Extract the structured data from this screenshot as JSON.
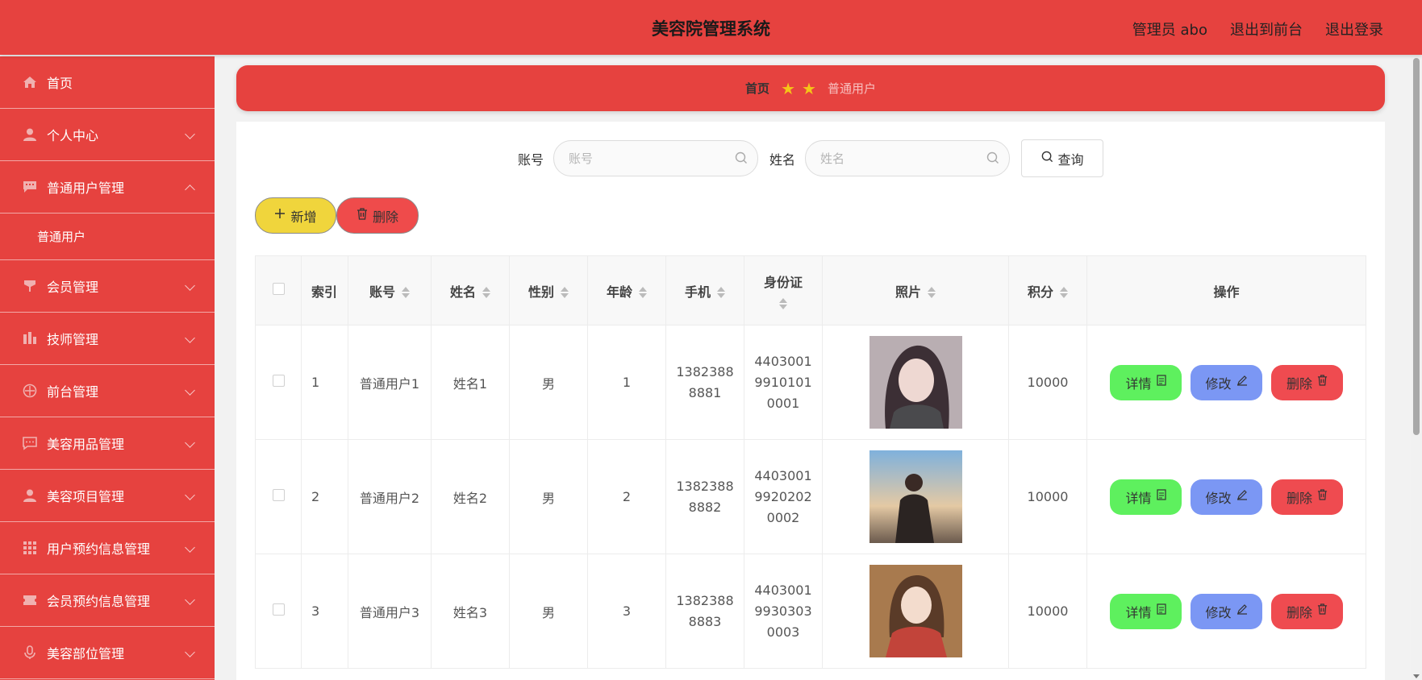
{
  "header": {
    "title": "美容院管理系统",
    "admin_label": "管理员 abo",
    "front_label": "退出到前台",
    "logout_label": "退出登录"
  },
  "sidebar": {
    "items": [
      {
        "label": "首页",
        "icon": "home-icon"
      },
      {
        "label": "个人中心",
        "icon": "user-icon"
      },
      {
        "label": "普通用户管理",
        "icon": "chat-icon",
        "expanded": true
      },
      {
        "label": "会员管理",
        "icon": "cup-icon"
      },
      {
        "label": "技师管理",
        "icon": "chart-icon"
      },
      {
        "label": "前台管理",
        "icon": "compass-icon"
      },
      {
        "label": "美容用品管理",
        "icon": "message-icon"
      },
      {
        "label": "美容项目管理",
        "icon": "user-icon"
      },
      {
        "label": "用户预约信息管理",
        "icon": "grid-icon"
      },
      {
        "label": "会员预约信息管理",
        "icon": "ticket-icon"
      },
      {
        "label": "美容部位管理",
        "icon": "mic-icon"
      }
    ],
    "sub_item": "普通用户"
  },
  "breadcrumb": {
    "home": "首页",
    "current": "普通用户",
    "separator_icon": "star-icon"
  },
  "search": {
    "account_label": "账号",
    "account_placeholder": "账号",
    "name_label": "姓名",
    "name_placeholder": "姓名",
    "query_label": "查询"
  },
  "actions": {
    "add_label": "新增",
    "delete_label": "删除"
  },
  "table": {
    "columns": [
      "索引",
      "账号",
      "姓名",
      "性别",
      "年龄",
      "手机",
      "身份证",
      "照片",
      "积分",
      "操作"
    ],
    "rows": [
      {
        "index": "1",
        "account": "普通用户1",
        "name": "姓名1",
        "gender": "男",
        "age": "1",
        "phone": "13823888881",
        "id_card": "440300199101010001",
        "points": "10000"
      },
      {
        "index": "2",
        "account": "普通用户2",
        "name": "姓名2",
        "gender": "男",
        "age": "2",
        "phone": "13823888882",
        "id_card": "440300199202020002",
        "points": "10000"
      },
      {
        "index": "3",
        "account": "普通用户3",
        "name": "姓名3",
        "gender": "男",
        "age": "3",
        "phone": "13823888883",
        "id_card": "440300199303030003",
        "points": "10000"
      }
    ],
    "ops": {
      "detail": "详情",
      "edit": "修改",
      "delete": "删除"
    }
  },
  "colors": {
    "primary": "#e6423f",
    "add_button": "#f0d53c",
    "delete_button": "#ef4b4b",
    "detail_button": "#5ef05e",
    "edit_button": "#7b97f4",
    "star": "#f5c518"
  }
}
